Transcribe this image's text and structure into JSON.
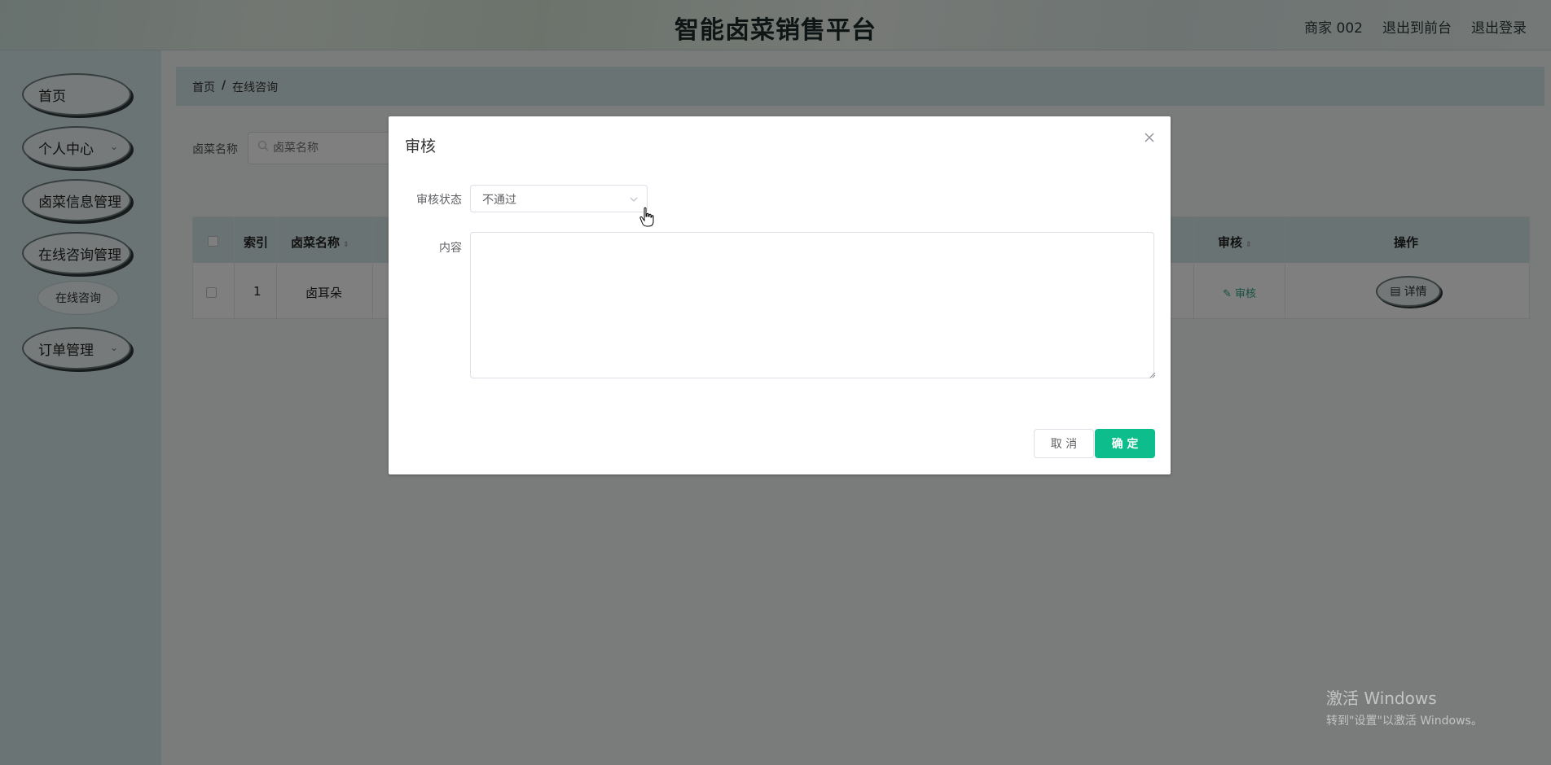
{
  "header": {
    "title": "智能卤菜销售平台",
    "user": "商家 002",
    "back_to_front": "退出到前台",
    "logout": "退出登录"
  },
  "sidebar": {
    "items": [
      {
        "label": "首页",
        "has_chevron": false
      },
      {
        "label": "个人中心",
        "has_chevron": true
      },
      {
        "label": "卤菜信息管理",
        "has_chevron": false
      },
      {
        "label": "在线咨询管理",
        "has_chevron": false
      },
      {
        "label": "在线咨询",
        "sub": true
      },
      {
        "label": "订单管理",
        "has_chevron": true
      }
    ]
  },
  "breadcrumb": {
    "home": "首页",
    "separator": "/",
    "current": "在线咨询"
  },
  "search": {
    "label": "卤菜名称",
    "placeholder": "卤菜名称"
  },
  "table": {
    "headers": {
      "index": "索引",
      "name": "卤菜名称",
      "audit": "审核",
      "action": "操作"
    },
    "rows": [
      {
        "index": "1",
        "name": "卤耳朵",
        "audit_link": "审核",
        "detail_button": "详情"
      }
    ]
  },
  "dialog": {
    "title": "审核",
    "status_label": "审核状态",
    "status_value": "不通过",
    "content_label": "内容",
    "content_value": "",
    "cancel": "取 消",
    "confirm": "确 定"
  },
  "watermark": {
    "line1": "激活 Windows",
    "line2": "转到\"设置\"以激活 Windows。"
  },
  "colors": {
    "accent": "#0dbd8b",
    "sidebar_bg": "#d5e8e8",
    "table_head_bg": "#d4e6e6"
  }
}
